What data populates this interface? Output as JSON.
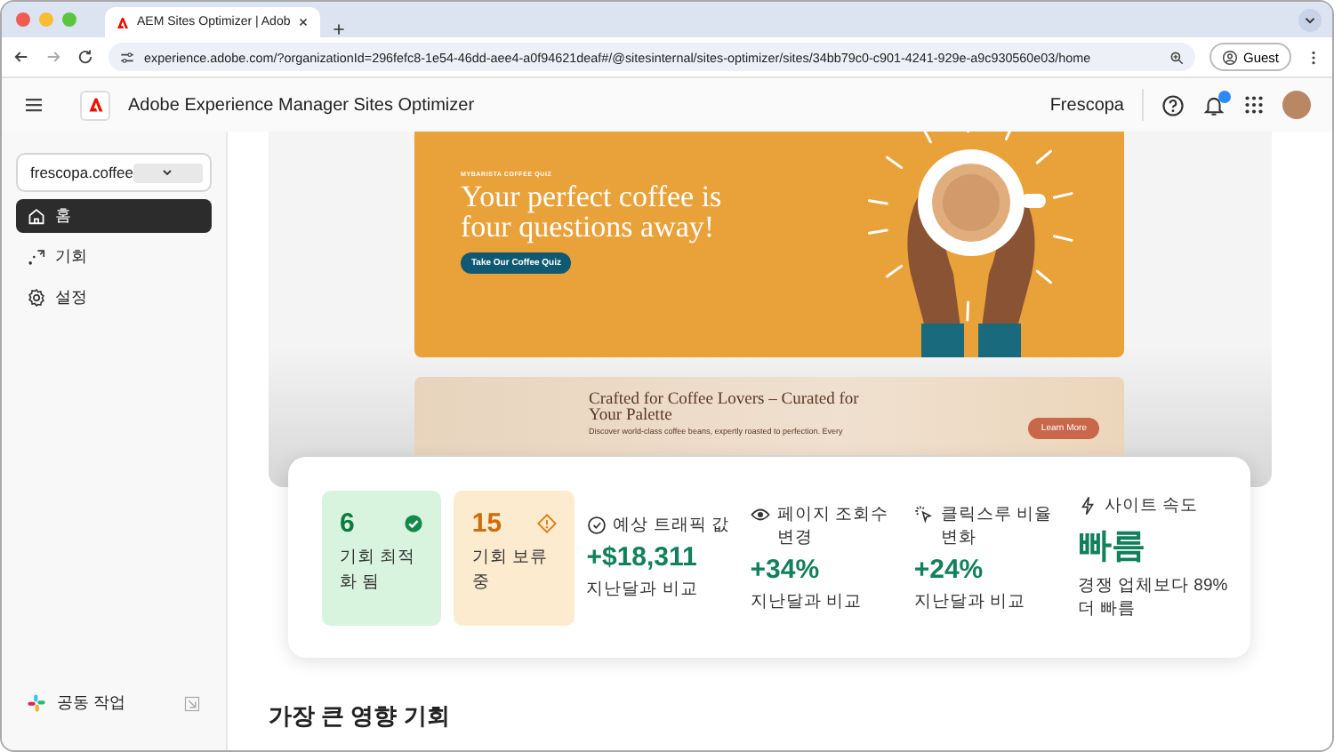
{
  "browser": {
    "tab_title": "AEM Sites Optimizer | Adob",
    "url": "experience.adobe.com/?organizationId=296fefc8-1e54-46dd-aee4-a0f94621deaf#/@sitesinternal/sites-optimizer/sites/34bb79c0-c901-4241-929e-a9c930560e03/home",
    "profile": "Guest"
  },
  "header": {
    "app_title": "Adobe Experience Manager Sites Optimizer",
    "org": "Frescopa",
    "notifications_unread": true
  },
  "sidebar": {
    "site_selector": "frescopa.coffee",
    "items": [
      {
        "label": "홈",
        "kind": "home",
        "selected": true
      },
      {
        "label": "기회",
        "kind": "opportunities",
        "selected": false
      },
      {
        "label": "설정",
        "kind": "settings",
        "selected": false
      }
    ],
    "footer": "공동 작업"
  },
  "preview": {
    "banners": [
      {
        "kind": "quiz",
        "eyebrow": "MYBARISTA COFFEE QUIZ",
        "headline": "Your perfect coffee is four questions away!",
        "button": "Take Our Coffee Quiz"
      },
      {
        "kind": "promo",
        "headline": "Crafted for Coffee Lovers – Curated for Your Palette",
        "text": "Discover world-class coffee beans, expertly roasted to perfection. Every",
        "button": "Learn More"
      }
    ]
  },
  "summary": {
    "tiles": [
      {
        "kind": "optimized",
        "value": "6",
        "label": "기회 최적화 됨"
      },
      {
        "kind": "pending",
        "value": "15",
        "label": "기회 보류 중"
      }
    ],
    "metrics": [
      {
        "kind": "traffic",
        "label": "예상 트래픽 값",
        "value": "+$18,311",
        "note": "지난달과 비교"
      },
      {
        "kind": "views",
        "label": "페이지 조회수 변경",
        "value": "+34%",
        "note": "지난달과 비교"
      },
      {
        "kind": "clicks",
        "label": "클릭스루 비율 변화",
        "value": "+24%",
        "note": "지난달과 비교"
      },
      {
        "kind": "speed",
        "label": "사이트 속도",
        "value": "빠름",
        "note": "경쟁 업체보다 89% 더 빠름"
      }
    ]
  },
  "section_heading": "가장 큰 영향 기회"
}
